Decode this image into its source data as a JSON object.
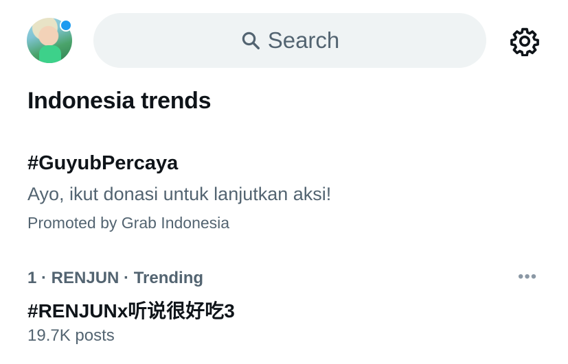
{
  "header": {
    "search_placeholder": "Search",
    "icons": {
      "search": "search-icon",
      "settings": "gear-icon",
      "avatar": "avatar"
    },
    "accent_color": "#1d9bf0"
  },
  "section": {
    "title": "Indonesia trends"
  },
  "promoted": {
    "tag": "#GuyubPercaya",
    "description": "Ayo, ikut donasi untuk lanjutkan aksi!",
    "promoted_by": "Promoted by Grab Indonesia"
  },
  "trends": [
    {
      "meta": "1 · RENJUN · Trending",
      "name": "#RENJUNx听说很好吃3",
      "posts": "19.7K posts",
      "more_label": "•••"
    }
  ]
}
